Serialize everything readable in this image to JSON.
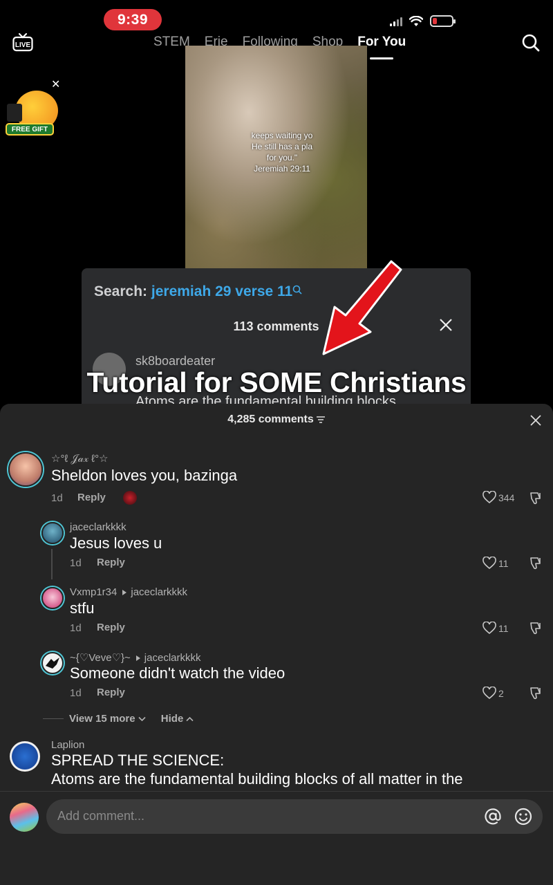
{
  "status": {
    "time": "9:39"
  },
  "top_nav": {
    "live_label": "LIVE",
    "tabs": [
      {
        "label": "STEM",
        "active": false
      },
      {
        "label": "Erie",
        "active": false
      },
      {
        "label": "Following",
        "active": false
      },
      {
        "label": "Shop",
        "active": false
      },
      {
        "label": "For You",
        "active": true
      }
    ]
  },
  "promo": {
    "badge": "FREE GIFT"
  },
  "video": {
    "verse_lines": [
      "keeps waiting yo",
      "He still has a pla",
      "for you.\"",
      "Jeremiah 29:11"
    ],
    "inner_search_label": "Search:",
    "inner_search_query": "jeremiah 29 verse 11",
    "inner_comments_count": "113 comments",
    "inner_username": "sk8boardeater",
    "inner_preview": "Atoms are the fundamental building blocks",
    "caption": "Tutorial for SOME Christians"
  },
  "comments_sheet": {
    "count_label": "4,285 comments",
    "comments": [
      {
        "user": "☆°ℓ 𝒥𝒶𝓍 ℓ°☆",
        "text": "Sheldon loves you, bazinga",
        "age": "1d",
        "reply_label": "Reply",
        "likes": "344"
      },
      {
        "user": "jaceclarkkkk",
        "text": "Jesus loves u",
        "age": "1d",
        "reply_label": "Reply",
        "likes": "11"
      },
      {
        "user": "Vxmp1r34",
        "reply_to": "jaceclarkkkk",
        "text": "stfu",
        "age": "1d",
        "reply_label": "Reply",
        "likes": "11"
      },
      {
        "user": "~{♡Veve♡}~",
        "reply_to": "jaceclarkkkk",
        "text": "Someone didn't watch the video",
        "age": "1d",
        "reply_label": "Reply",
        "likes": "2"
      }
    ],
    "view_more_label": "View 15 more",
    "hide_label": "Hide",
    "next_comment": {
      "user": "Laplion",
      "text_line1": "SPREAD THE SCIENCE:",
      "text_line2": "Atoms are the fundamental building blocks of all matter in the"
    },
    "input_placeholder": "Add comment..."
  },
  "colors": {
    "accent_ring": "#4fc7d6",
    "search_query": "#3ea8e8",
    "status_pill": "#e0353b",
    "sheet_bg": "#252525"
  }
}
